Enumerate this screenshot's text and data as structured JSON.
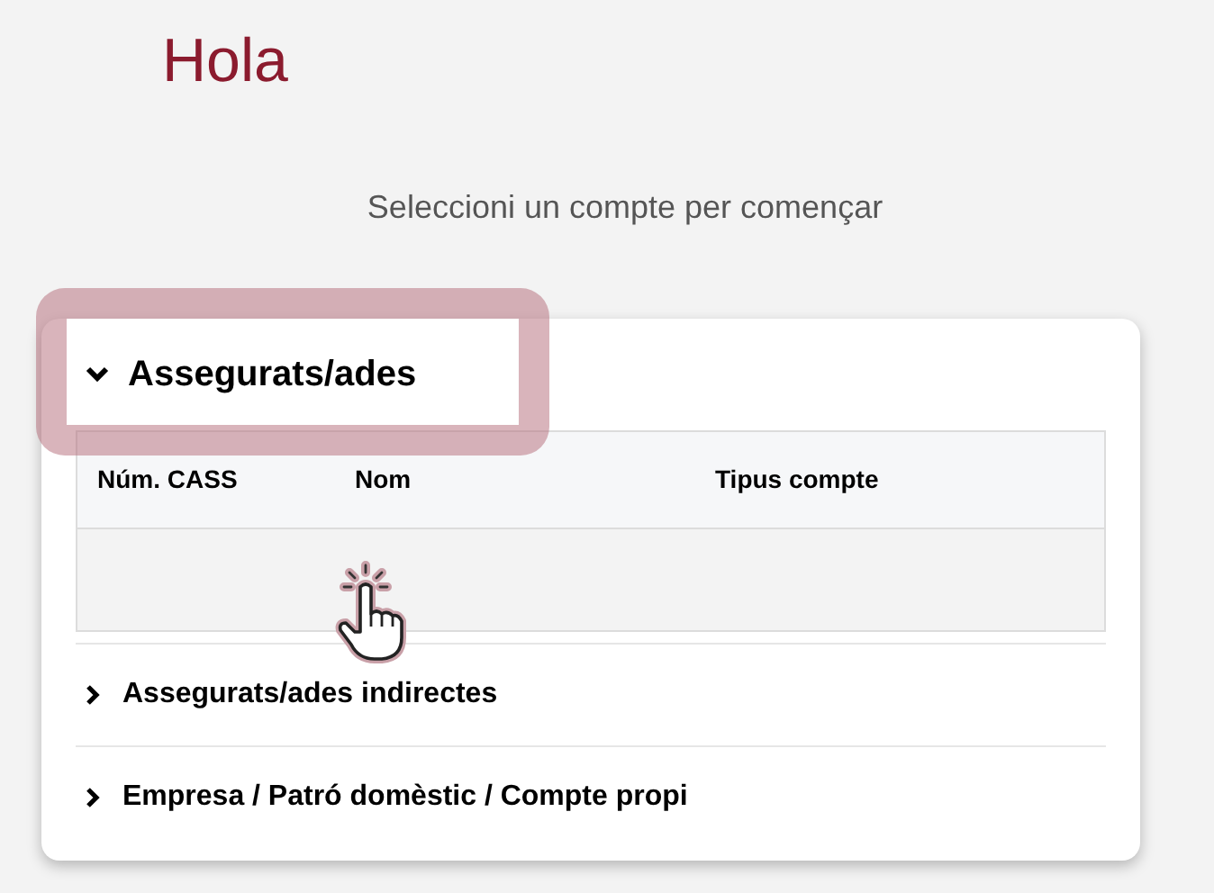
{
  "greeting": "Hola",
  "subtitle": "Seleccioni un compte per començar",
  "sections": [
    {
      "title": "Assegurats/ades",
      "expanded": true,
      "highlighted": true,
      "table": {
        "columns": [
          "Núm. CASS",
          "Nom",
          "Tipus compte"
        ]
      }
    },
    {
      "title": "Assegurats/ades indirectes",
      "expanded": false,
      "highlighted": false
    },
    {
      "title": "Empresa / Patró domèstic / Compte propi",
      "expanded": false,
      "highlighted": false
    }
  ]
}
